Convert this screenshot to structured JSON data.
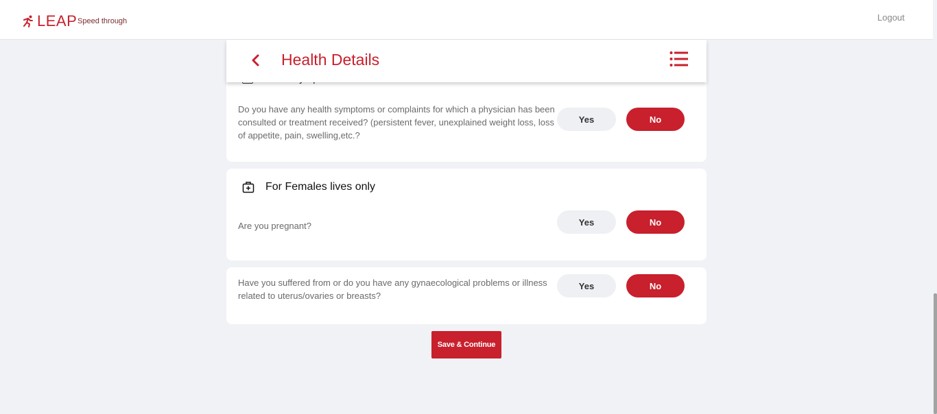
{
  "brand": {
    "name": "LEAP",
    "tagline": "Speed through",
    "logo_icon": "runner-icon",
    "accent": "#c8202c"
  },
  "topbar": {
    "logout_label": "Logout"
  },
  "header": {
    "title": "Health Details",
    "back_icon": "chevron-left-icon",
    "menu_icon": "list-menu-icon"
  },
  "sections": [
    {
      "title": "Other symptoms",
      "icon": "clipboard-icon",
      "questions": [
        {
          "text": "Do you have any health symptoms or complaints for which a physician has been consulted or treatment received? (persistent fever, unexplained weight loss, loss of appetite, pain, swelling,etc.?",
          "yes_label": "Yes",
          "no_label": "No",
          "selected": "No"
        }
      ]
    },
    {
      "title": "For Females lives only",
      "icon": "medical-kit-icon",
      "questions": [
        {
          "text": "Are you pregnant?",
          "yes_label": "Yes",
          "no_label": "No",
          "selected": "No"
        },
        {
          "text": "Have you suffered from or do you have any gynaecological problems or illness related to uterus/ovaries or breasts?",
          "yes_label": "Yes",
          "no_label": "No",
          "selected": "No"
        }
      ]
    }
  ],
  "footer": {
    "save_label": "Save & Continue"
  }
}
